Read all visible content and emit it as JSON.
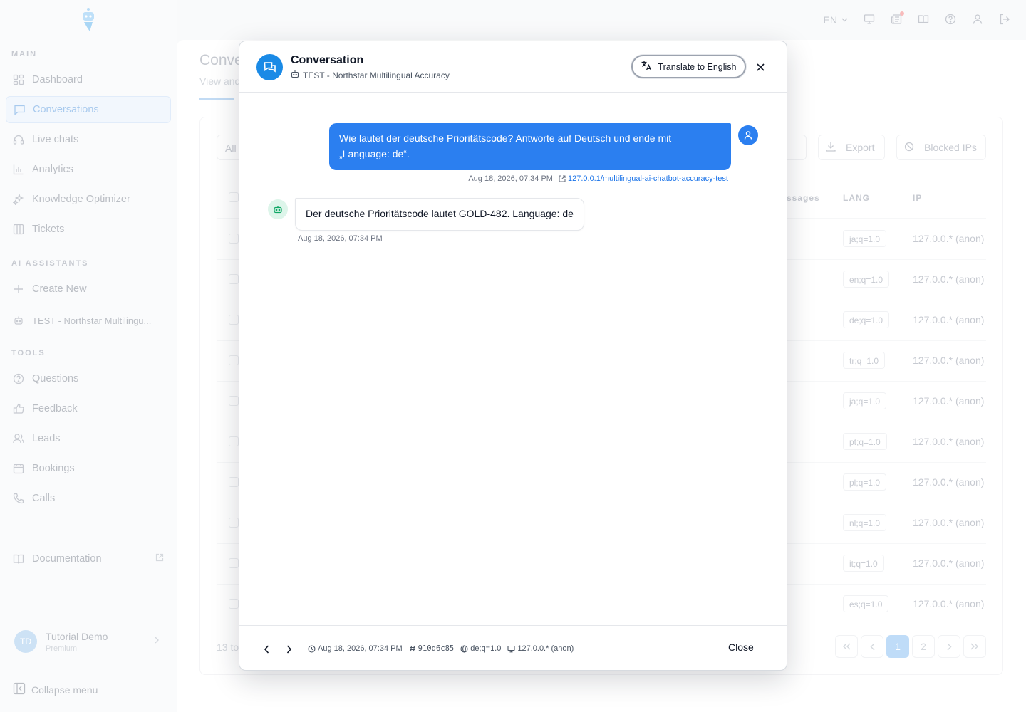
{
  "sidebar": {
    "sections": {
      "main": "MAIN",
      "ai": "AI ASSISTANTS",
      "tools": "TOOLS"
    },
    "main_items": [
      {
        "label": "Dashboard",
        "icon": "grid-icon"
      },
      {
        "label": "Conversations",
        "icon": "chat-icon",
        "active": true
      },
      {
        "label": "Live chats",
        "icon": "headset-icon"
      },
      {
        "label": "Analytics",
        "icon": "bar-chart-icon"
      },
      {
        "label": "Knowledge Optimizer",
        "icon": "sparkle-icon"
      },
      {
        "label": "Tickets",
        "icon": "columns-icon"
      }
    ],
    "ai_items": [
      {
        "label": "Create New",
        "icon": "plus-icon"
      },
      {
        "label": "TEST - Northstar Multilingu...",
        "icon": "bot-icon"
      }
    ],
    "tools_items": [
      {
        "label": "Questions",
        "icon": "question-icon"
      },
      {
        "label": "Feedback",
        "icon": "thumbs-up-icon"
      },
      {
        "label": "Leads",
        "icon": "users-icon"
      },
      {
        "label": "Bookings",
        "icon": "calendar-icon"
      },
      {
        "label": "Calls",
        "icon": "phone-icon"
      }
    ],
    "documentation": "Documentation",
    "user": {
      "initials": "TD",
      "name": "Tutorial Demo",
      "plan": "Premium"
    },
    "collapse": "Collapse menu"
  },
  "topbar": {
    "language": "EN"
  },
  "page": {
    "title": "Conve",
    "subtitle": "View and",
    "filter_all": "All",
    "export": "Export",
    "blocked_ips": "Blocked IPs",
    "columns": {
      "messages": "ssages",
      "lang": "LANG",
      "ip": "IP"
    },
    "rows": [
      {
        "lang": "ja;q=1.0",
        "ip": "127.0.0.* (anon)"
      },
      {
        "lang": "en;q=1.0",
        "ip": "127.0.0.* (anon)"
      },
      {
        "lang": "de;q=1.0",
        "ip": "127.0.0.* (anon)"
      },
      {
        "lang": "tr;q=1.0",
        "ip": "127.0.0.* (anon)"
      },
      {
        "lang": "ja;q=1.0",
        "ip": "127.0.0.* (anon)"
      },
      {
        "lang": "pt;q=1.0",
        "ip": "127.0.0.* (anon)"
      },
      {
        "lang": "pl;q=1.0",
        "ip": "127.0.0.* (anon)"
      },
      {
        "lang": "nl;q=1.0",
        "ip": "127.0.0.* (anon)"
      },
      {
        "lang": "it;q=1.0",
        "ip": "127.0.0.* (anon)"
      },
      {
        "lang": "es;q=1.0",
        "ip": "127.0.0.* (anon)"
      }
    ],
    "footer_count": "13 to",
    "pages": [
      "1",
      "2"
    ],
    "current_page": "1"
  },
  "modal": {
    "title": "Conversation",
    "assistant": "TEST - Northstar Multilingual Accuracy",
    "translate_label": "Translate to English",
    "messages": [
      {
        "role": "user",
        "text": "Wie lautet der deutsche Prioritätscode? Antworte auf Deutsch und ende mit „Language: de“.",
        "time": "Aug 18, 2026, 07:34 PM",
        "url": "127.0.0.1/multilingual-ai-chatbot-accuracy-test"
      },
      {
        "role": "bot",
        "text": "Der deutsche Prioritätscode lautet GOLD-482. Language: de",
        "time": "Aug 18, 2026, 07:34 PM"
      }
    ],
    "footer": {
      "time": "Aug 18, 2026, 07:34 PM",
      "id": "910d6c85",
      "lang": "de;q=1.0",
      "ip": "127.0.0.* (anon)",
      "close": "Close"
    }
  }
}
